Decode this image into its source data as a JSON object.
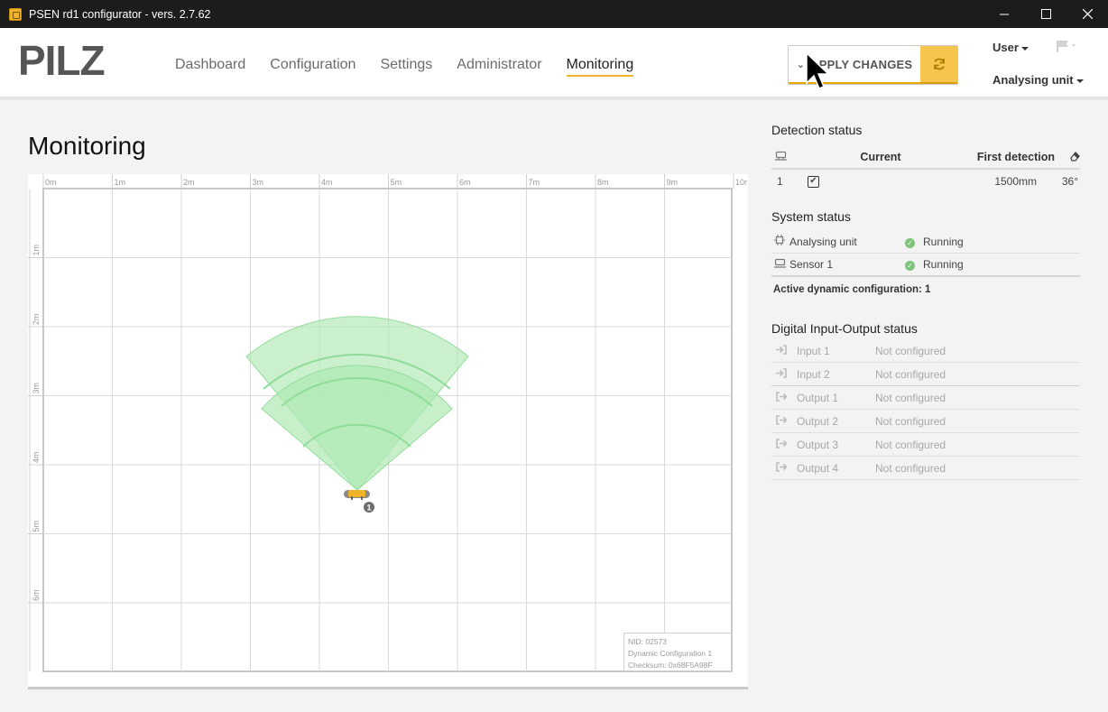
{
  "window": {
    "title": "PSEN rd1 configurator - vers. 2.7.62",
    "controls": [
      "minimize",
      "maximize",
      "close"
    ]
  },
  "header": {
    "logo_text": "PILZ",
    "nav": [
      {
        "label": "Dashboard",
        "active": false
      },
      {
        "label": "Configuration",
        "active": false
      },
      {
        "label": "Settings",
        "active": false
      },
      {
        "label": "Administrator",
        "active": false
      },
      {
        "label": "Monitoring",
        "active": true
      }
    ],
    "apply_label": "APPLY CHANGES",
    "user_label": "User",
    "unit_label": "Analysing unit",
    "accent_color": "#f0b32a"
  },
  "main": {
    "title": "Monitoring",
    "map": {
      "x_ticks": [
        "0m",
        "1m",
        "2m",
        "3m",
        "4m",
        "5m",
        "6m",
        "7m",
        "8m",
        "9m",
        "10r"
      ],
      "y_ticks": [
        "1m",
        "2m",
        "3m",
        "4m",
        "5m",
        "6m"
      ],
      "sensor_id": "1",
      "info": {
        "nid": "NID: 02573",
        "config": "Dynamic Configuration 1",
        "checksum": "Checksum: 0x68F5A98F"
      }
    }
  },
  "panel": {
    "detection": {
      "title": "Detection status",
      "col_current": "Current",
      "col_first": "First detection",
      "rows": [
        {
          "id": "1",
          "checked": true,
          "distance": "1500mm",
          "angle": "36°"
        }
      ]
    },
    "system": {
      "title": "System status",
      "rows": [
        {
          "label": "Analysing unit",
          "status": "Running"
        },
        {
          "label": "Sensor 1",
          "status": "Running"
        }
      ],
      "active_config": "Active dynamic configuration: 1"
    },
    "io": {
      "title": "Digital Input-Output status",
      "rows": [
        {
          "label": "Input 1",
          "status": "Not configured",
          "kind": "input"
        },
        {
          "label": "Input 2",
          "status": "Not configured",
          "kind": "input"
        },
        {
          "label": "Output 1",
          "status": "Not configured",
          "kind": "output"
        },
        {
          "label": "Output 2",
          "status": "Not configured",
          "kind": "output"
        },
        {
          "label": "Output 3",
          "status": "Not configured",
          "kind": "output"
        },
        {
          "label": "Output 4",
          "status": "Not configured",
          "kind": "output"
        }
      ]
    }
  }
}
